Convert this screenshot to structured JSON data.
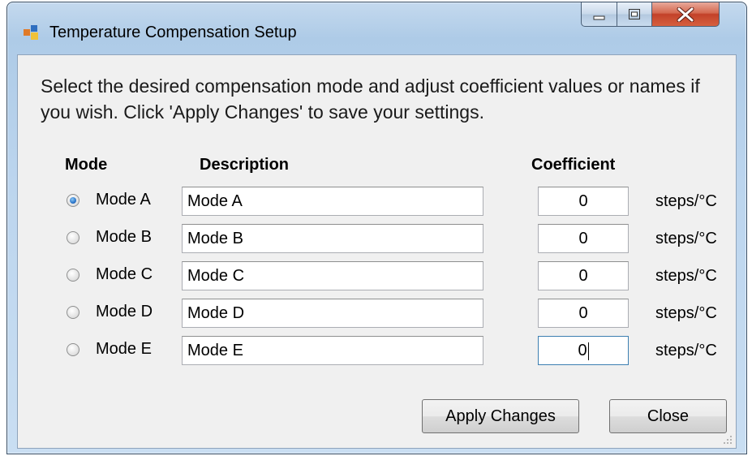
{
  "window": {
    "title": "Temperature Compensation Setup",
    "minimize_icon": "minimize-icon",
    "maximize_icon": "maximize-icon",
    "close_icon": "close-x-icon"
  },
  "instructions": "Select the desired compensation mode and adjust coefficient values or names if you wish. Click 'Apply Changes' to save your settings.",
  "headers": {
    "mode": "Mode",
    "description": "Description",
    "coefficient": "Coefficient"
  },
  "rows": [
    {
      "mode": "Mode A",
      "description": "Mode A",
      "coefficient": "0",
      "unit": "steps/°C",
      "selected": true
    },
    {
      "mode": "Mode B",
      "description": "Mode B",
      "coefficient": "0",
      "unit": "steps/°C",
      "selected": false
    },
    {
      "mode": "Mode C",
      "description": "Mode C",
      "coefficient": "0",
      "unit": "steps/°C",
      "selected": false
    },
    {
      "mode": "Mode D",
      "description": "Mode D",
      "coefficient": "0",
      "unit": "steps/°C",
      "selected": false
    },
    {
      "mode": "Mode E",
      "description": "Mode E",
      "coefficient": "0",
      "unit": "steps/°C",
      "selected": false
    }
  ],
  "buttons": {
    "apply": "Apply Changes",
    "close": "Close"
  },
  "colors": {
    "title_bar": "#bcd5ee",
    "client_bg": "#f0f0f0",
    "close_button": "#c24129",
    "radio_checked": "#2a74c9"
  }
}
